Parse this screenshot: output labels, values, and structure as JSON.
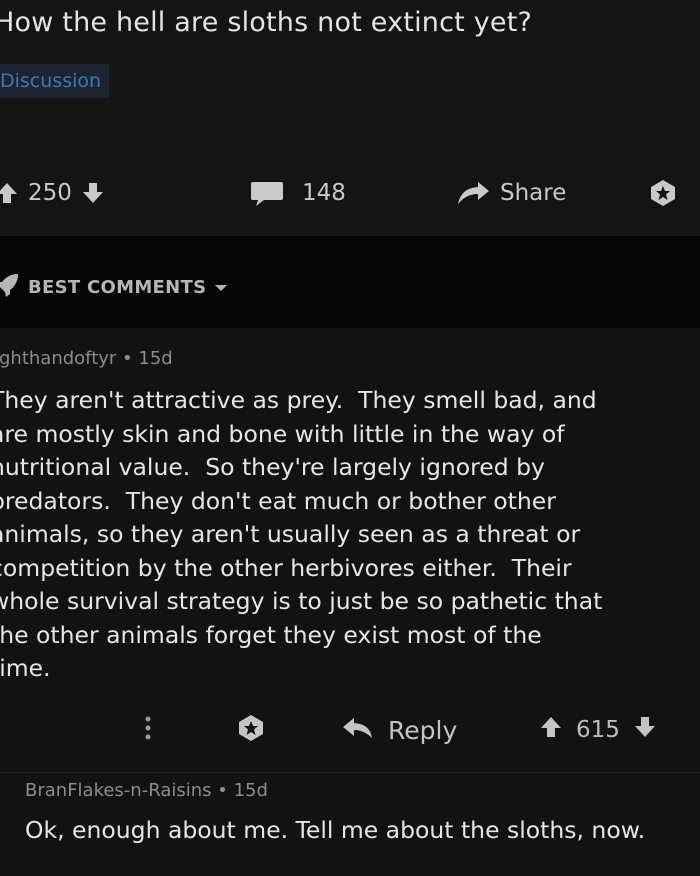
{
  "post": {
    "title": "How the hell are sloths not extinct yet?",
    "flair": "Discussion",
    "score": "250",
    "comment_count": "148",
    "share_label": "Share"
  },
  "sort": {
    "label": "BEST COMMENTS"
  },
  "comments": [
    {
      "author": "ighthandoftyr",
      "age": "15d",
      "body": "They aren't attractive as prey.  They smell bad, and\nare mostly skin and bone with little in the way of\nnutritional value.  So they're largely ignored by\npredators.  They don't eat much or bother other\nanimals, so they aren't usually seen as a threat or\ncompetition by the other herbivores either.  Their\nwhole survival strategy is to just be so pathetic that\nthe other animals forget they exist most of the\ntime.",
      "reply_label": "Reply",
      "score": "615"
    },
    {
      "author": "BranFlakes-n-Raisins",
      "age": "15d",
      "body": "Ok, enough about me. Tell me about the sloths, now."
    }
  ],
  "icons": {
    "upvote": "arrow-up-icon",
    "downvote": "arrow-down-icon",
    "comments": "speech-bubble-icon",
    "share": "share-arrow-icon",
    "save": "bookmark-star-icon",
    "sort": "rocket-icon",
    "sort_caret": "caret-down-icon",
    "more": "vertical-dots-icon",
    "reply": "reply-arrow-icon"
  },
  "colors": {
    "background": "#121212",
    "sort_bar": "#050505",
    "flair_bg": "#1d2430",
    "flair_text": "#3c79b5",
    "meta_text": "#8c8c8c",
    "body_text": "#e6e6e6"
  }
}
